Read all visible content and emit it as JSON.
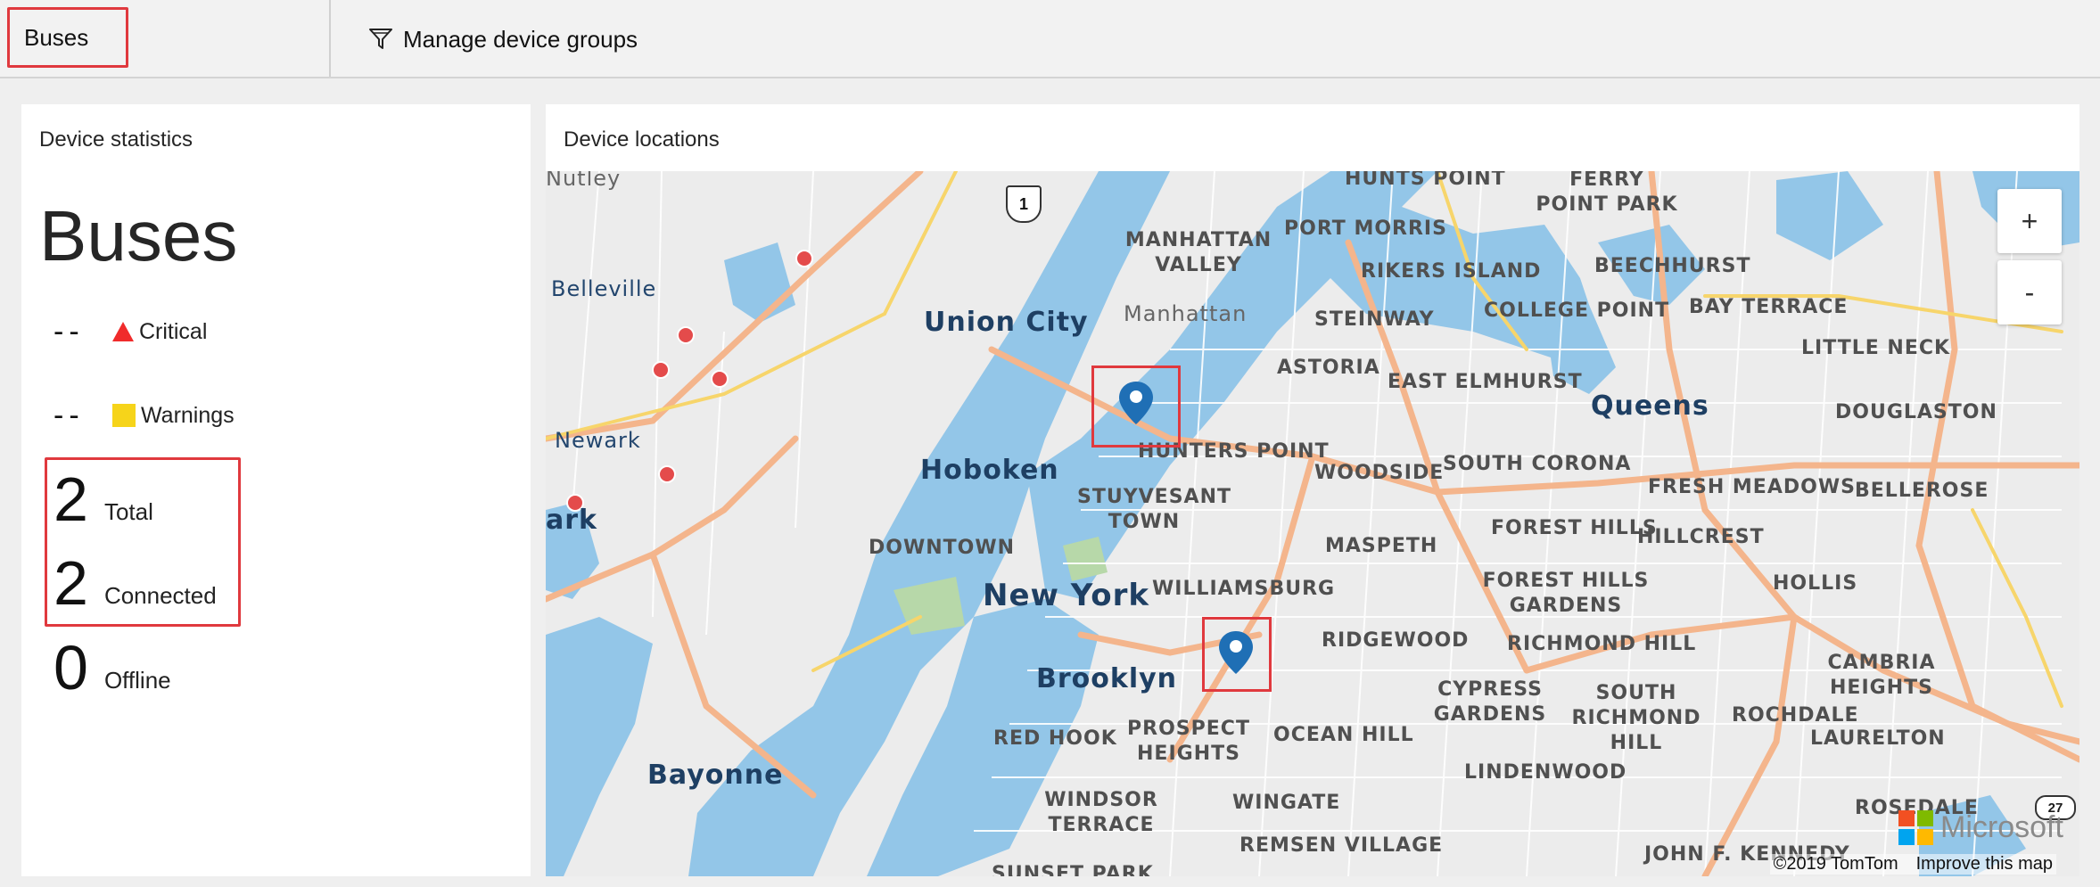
{
  "topbar": {
    "group_selector": "Buses",
    "manage_label": "Manage device groups"
  },
  "stats": {
    "panel_title": "Device statistics",
    "heading": "Buses",
    "critical": {
      "value": "--",
      "label": "Critical"
    },
    "warnings": {
      "value": "--",
      "label": "Warnings"
    },
    "total": {
      "value": "2",
      "label": "Total"
    },
    "connected": {
      "value": "2",
      "label": "Connected"
    },
    "offline": {
      "value": "0",
      "label": "Offline"
    }
  },
  "map": {
    "panel_title": "Device locations",
    "zoom_in": "+",
    "zoom_out": "-",
    "labels": {
      "nutley": "Nutley",
      "belleville": "Belleville",
      "newark": "Newark",
      "ark": "ark",
      "union_city": "Union City",
      "hoboken": "Hoboken",
      "downtown": "DOWNTOWN",
      "new_york": "New York",
      "brooklyn": "Brooklyn",
      "bayonne": "Bayonne",
      "manhattan_valley": "MANHATTAN VALLEY",
      "manhattan": "Manhattan",
      "hunts_point": "HUNTS POINT",
      "ferry_point": "FERRY POINT PARK",
      "port_morris": "PORT MORRIS",
      "rikers": "RIKERS ISLAND",
      "beechhurst": "BEECHHURST",
      "college_point": "COLLEGE POINT",
      "bay_terrace": "BAY TERRACE",
      "steinway": "STEINWAY",
      "little_neck": "LITTLE NECK",
      "astoria": "ASTORIA",
      "east_elmhurst": "EAST ELMHURST",
      "queens": "Queens",
      "douglaston": "DOUGLASTON",
      "hunters_point": "HUNTERS POINT",
      "woodside": "WOODSIDE",
      "south_corona": "SOUTH CORONA",
      "fresh_meadows": "FRESH MEADOWS",
      "bellerose": "BELLEROSE",
      "stuyvesant": "STUYVESANT TOWN",
      "maspeth": "MASPETH",
      "forest_hills": "FOREST HILLS",
      "hillcrest": "HILLCREST",
      "williamsburg": "WILLIAMSBURG",
      "forest_hills_gardens": "FOREST HILLS GARDENS",
      "hollis": "HOLLIS",
      "ridgewood": "RIDGEWOOD",
      "richmond_hill": "RICHMOND HILL",
      "cambria_heights": "CAMBRIA HEIGHTS",
      "cypress_hills": "CYPRESS GARDENS",
      "south_richmond_hill": "SOUTH RICHMOND HILL",
      "rochdale": "ROCHDALE",
      "red_hook": "RED HOOK",
      "prospect_heights": "PROSPECT HEIGHTS",
      "ocean_hill": "OCEAN HILL",
      "laurelton": "LAURELTON",
      "lindenwood": "LINDENWOOD",
      "windsor_terrace": "WINDSOR TERRACE",
      "wingate": "WINGATE",
      "remsen_village": "REMSEN VILLAGE",
      "rosedale": "ROSEDALE",
      "jfk": "JOHN F. KENNEDY",
      "sunset_park": "SUNSET PARK"
    },
    "route_shield": "1",
    "route_27": "27",
    "microsoft": "Microsoft",
    "attribution": "©2019 TomTom",
    "improve": "Improve this map",
    "colors": {
      "water": "#93c6e8",
      "land": "#ececec",
      "highway": "#f4b58c",
      "major": "#f7d56b",
      "pin": "#1f6fb5",
      "highlight": "#e0393e"
    }
  }
}
